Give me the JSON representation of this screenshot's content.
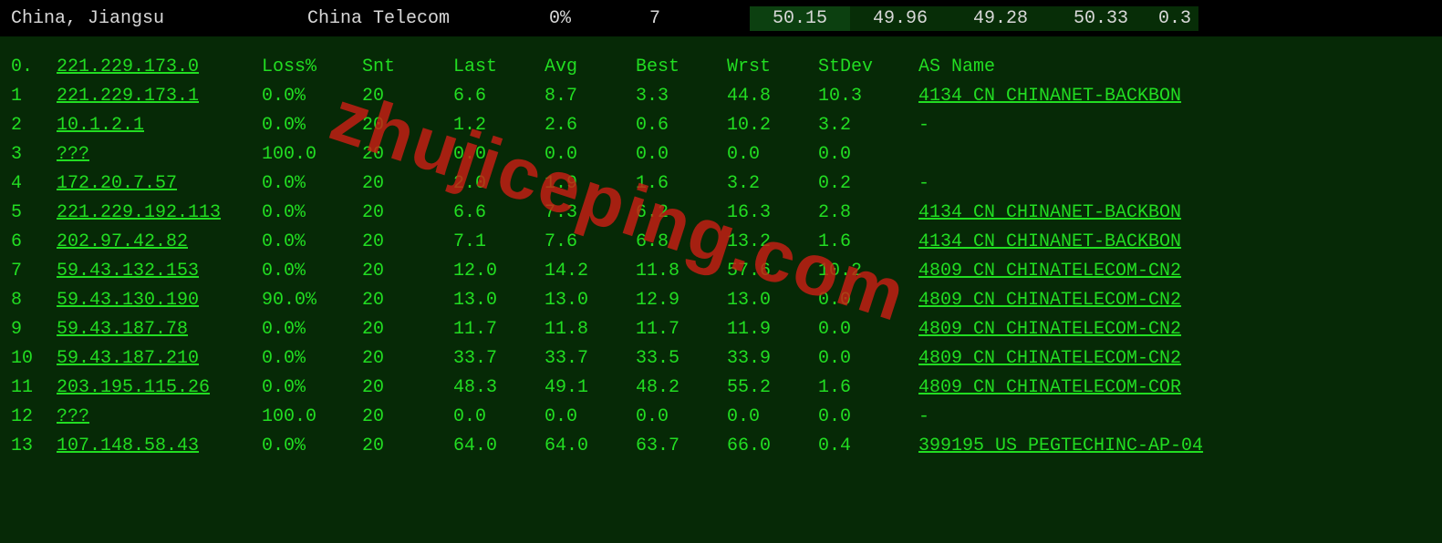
{
  "topbar": {
    "location": "China, Jiangsu",
    "carrier": "China Telecom",
    "loss": "0%",
    "count": "7",
    "pings": [
      "50.15",
      "49.96",
      "49.28",
      "50.33"
    ],
    "tail": "0.3"
  },
  "header": {
    "hop": "0.",
    "ip": "221.229.173.0",
    "loss": "Loss%",
    "snt": "Snt",
    "last": "Last",
    "avg": "Avg",
    "best": "Best",
    "wrst": "Wrst",
    "stdev": "StDev",
    "as": "AS Name"
  },
  "hops": [
    {
      "n": "1",
      "ip": "221.229.173.1",
      "loss": "0.0%",
      "snt": "20",
      "last": "6.6",
      "avg": "8.7",
      "best": "3.3",
      "wrst": "44.8",
      "stdev": "10.3",
      "as": "4134  CN CHINANET-BACKBON"
    },
    {
      "n": "2",
      "ip": "10.1.2.1",
      "loss": "0.0%",
      "snt": "20",
      "last": "1.2",
      "avg": "2.6",
      "best": "0.6",
      "wrst": "10.2",
      "stdev": "3.2",
      "as": "-"
    },
    {
      "n": "3",
      "ip": "???",
      "loss": "100.0",
      "snt": "20",
      "last": "0.0",
      "avg": "0.0",
      "best": "0.0",
      "wrst": "0.0",
      "stdev": "0.0",
      "as": ""
    },
    {
      "n": "4",
      "ip": "172.20.7.57",
      "loss": "0.0%",
      "snt": "20",
      "last": "2.0",
      "avg": "1.9",
      "best": "1.6",
      "wrst": "3.2",
      "stdev": "0.2",
      "as": "-"
    },
    {
      "n": "5",
      "ip": "221.229.192.113",
      "loss": "0.0%",
      "snt": "20",
      "last": "6.6",
      "avg": "7.3",
      "best": "6.2",
      "wrst": "16.3",
      "stdev": "2.8",
      "as": "4134  CN CHINANET-BACKBON"
    },
    {
      "n": "6",
      "ip": "202.97.42.82",
      "loss": "0.0%",
      "snt": "20",
      "last": "7.1",
      "avg": "7.6",
      "best": "6.8",
      "wrst": "13.2",
      "stdev": "1.6",
      "as": "4134  CN CHINANET-BACKBON"
    },
    {
      "n": "7",
      "ip": "59.43.132.153",
      "loss": "0.0%",
      "snt": "20",
      "last": "12.0",
      "avg": "14.2",
      "best": "11.8",
      "wrst": "57.6",
      "stdev": "10.2",
      "as": "4809  CN CHINATELECOM-CN2"
    },
    {
      "n": "8",
      "ip": "59.43.130.190",
      "loss": "90.0%",
      "snt": "20",
      "last": "13.0",
      "avg": "13.0",
      "best": "12.9",
      "wrst": "13.0",
      "stdev": "0.0",
      "as": "4809  CN CHINATELECOM-CN2"
    },
    {
      "n": "9",
      "ip": "59.43.187.78",
      "loss": "0.0%",
      "snt": "20",
      "last": "11.7",
      "avg": "11.8",
      "best": "11.7",
      "wrst": "11.9",
      "stdev": "0.0",
      "as": "4809  CN CHINATELECOM-CN2"
    },
    {
      "n": "10",
      "ip": "59.43.187.210",
      "loss": "0.0%",
      "snt": "20",
      "last": "33.7",
      "avg": "33.7",
      "best": "33.5",
      "wrst": "33.9",
      "stdev": "0.0",
      "as": "4809  CN CHINATELECOM-CN2"
    },
    {
      "n": "11",
      "ip": "203.195.115.26",
      "loss": "0.0%",
      "snt": "20",
      "last": "48.3",
      "avg": "49.1",
      "best": "48.2",
      "wrst": "55.2",
      "stdev": "1.6",
      "as": "4809  CN CHINATELECOM-COR"
    },
    {
      "n": "12",
      "ip": "???",
      "loss": "100.0",
      "snt": "20",
      "last": "0.0",
      "avg": "0.0",
      "best": "0.0",
      "wrst": "0.0",
      "stdev": "0.0",
      "as": "-"
    },
    {
      "n": "13",
      "ip": "107.148.58.43",
      "loss": "0.0%",
      "snt": "20",
      "last": "64.0",
      "avg": "64.0",
      "best": "63.7",
      "wrst": "66.0",
      "stdev": "0.4",
      "as": "399195 US PEGTECHINC-AP-04"
    }
  ],
  "watermark": "zhujiceping.com"
}
